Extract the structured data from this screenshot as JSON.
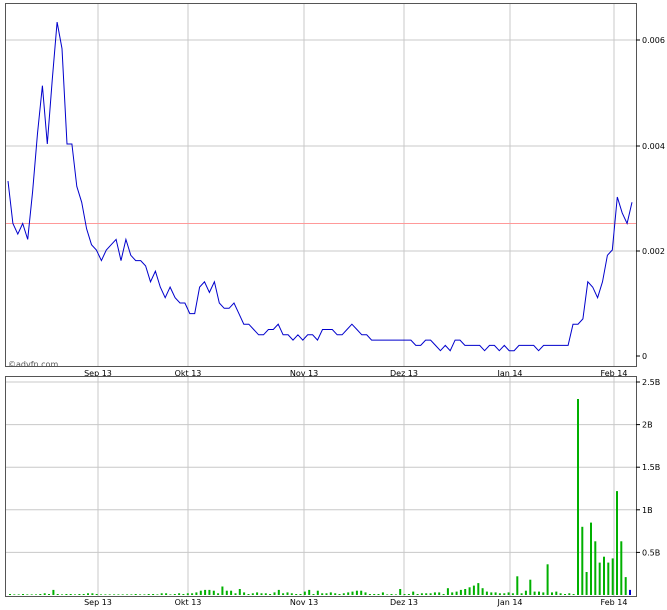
{
  "watermark": "©advfn.com",
  "chart_data": [
    {
      "type": "line",
      "panel": "price",
      "title": "",
      "xlabel": "",
      "ylabel": "",
      "x_ticks": [
        "Sep 13",
        "Okt 13",
        "Nov 13",
        "Dez 13",
        "Jan 14",
        "Feb 14"
      ],
      "y_ticks": [
        "0.006",
        "0.004",
        "0.002",
        "0"
      ],
      "ylim": [
        0,
        0.0067
      ],
      "grid": true,
      "reference_line": {
        "value": 0.0025,
        "color": "#ff9999"
      },
      "series": [
        {
          "color": "#0000cc",
          "values": [
            0.0033,
            0.0025,
            0.0023,
            0.0025,
            0.0022,
            0.0031,
            0.0042,
            0.0051,
            0.004,
            0.0052,
            0.0063,
            0.0058,
            0.004,
            0.004,
            0.0032,
            0.0029,
            0.0024,
            0.0021,
            0.002,
            0.0018,
            0.002,
            0.0021,
            0.0022,
            0.0018,
            0.0022,
            0.0019,
            0.0018,
            0.0018,
            0.0017,
            0.0014,
            0.0016,
            0.0013,
            0.0011,
            0.0013,
            0.0011,
            0.001,
            0.001,
            0.0008,
            0.0008,
            0.0013,
            0.0014,
            0.0012,
            0.0014,
            0.001,
            0.0009,
            0.0009,
            0.001,
            0.0008,
            0.0006,
            0.0006,
            0.0005,
            0.0004,
            0.0004,
            0.0005,
            0.0005,
            0.0006,
            0.0004,
            0.0004,
            0.0003,
            0.0004,
            0.0003,
            0.0004,
            0.0004,
            0.0003,
            0.0005,
            0.0005,
            0.0005,
            0.0004,
            0.0004,
            0.0005,
            0.0006,
            0.0005,
            0.0004,
            0.0004,
            0.0003,
            0.0003,
            0.0003,
            0.0003,
            0.0003,
            0.0003,
            0.0003,
            0.0003,
            0.0003,
            0.0002,
            0.0002,
            0.0003,
            0.0003,
            0.0002,
            0.0001,
            0.0002,
            0.0001,
            0.0003,
            0.0003,
            0.0002,
            0.0002,
            0.0002,
            0.0002,
            0.0001,
            0.0002,
            0.0002,
            0.0001,
            0.0002,
            0.0001,
            0.0001,
            0.0002,
            0.0002,
            0.0002,
            0.0002,
            0.0001,
            0.0002,
            0.0002,
            0.0002,
            0.0002,
            0.0002,
            0.0002,
            0.0006,
            0.0006,
            0.0007,
            0.0014,
            0.0013,
            0.0011,
            0.0014,
            0.0019,
            0.002,
            0.003,
            0.0027,
            0.0025,
            0.0029
          ]
        }
      ]
    },
    {
      "type": "bar",
      "panel": "volume",
      "title": "",
      "xlabel": "",
      "ylabel": "",
      "x_ticks": [
        "Sep 13",
        "Okt 13",
        "Nov 13",
        "Dez 13",
        "Jan 14",
        "Feb 14"
      ],
      "y_ticks": [
        "2.5B",
        "2B",
        "1.5B",
        "1B",
        "0.5B"
      ],
      "ylim": [
        0,
        2.5
      ],
      "units": "B",
      "grid": true,
      "bar_color": "#00b000",
      "last_bar_color": "#0000cc",
      "values": [
        0.01,
        0.0,
        0.0,
        0.01,
        0.0,
        0.0,
        0.0,
        0.01,
        0.02,
        0.01,
        0.06,
        0.01,
        0.0,
        0.01,
        0.01,
        0.0,
        0.01,
        0.01,
        0.02,
        0.02,
        0.01,
        0.0,
        0.0,
        0.0,
        0.0,
        0.0,
        0.0,
        0.0,
        0.0,
        0.01,
        0.0,
        0.0,
        0.01,
        0.01,
        0.0,
        0.02,
        0.02,
        0.0,
        0.01,
        0.02,
        0.01,
        0.02,
        0.02,
        0.03,
        0.05,
        0.06,
        0.06,
        0.05,
        0.02,
        0.1,
        0.05,
        0.05,
        0.02,
        0.07,
        0.03,
        0.01,
        0.02,
        0.03,
        0.02,
        0.02,
        0.01,
        0.03,
        0.06,
        0.02,
        0.03,
        0.02,
        0.01,
        0.01,
        0.04,
        0.06,
        0.01,
        0.05,
        0.02,
        0.02,
        0.03,
        0.02,
        0.01,
        0.02,
        0.03,
        0.04,
        0.05,
        0.05,
        0.03,
        0.01,
        0.01,
        0.01,
        0.03,
        0.0,
        0.01,
        0.0,
        0.07,
        0.01,
        0.01,
        0.04,
        0.01,
        0.02,
        0.02,
        0.02,
        0.03,
        0.03,
        0.01,
        0.08,
        0.03,
        0.04,
        0.06,
        0.07,
        0.09,
        0.11,
        0.14,
        0.08,
        0.04,
        0.03,
        0.03,
        0.02,
        0.02,
        0.03,
        0.02,
        0.22,
        0.02,
        0.05,
        0.18,
        0.04,
        0.04,
        0.03,
        0.36,
        0.03,
        0.04,
        0.02,
        0.01,
        0.02,
        0.01,
        2.3,
        0.8,
        0.27,
        0.85,
        0.63,
        0.38,
        0.45,
        0.38,
        0.43,
        1.22,
        0.63,
        0.21,
        0.06
      ]
    }
  ]
}
